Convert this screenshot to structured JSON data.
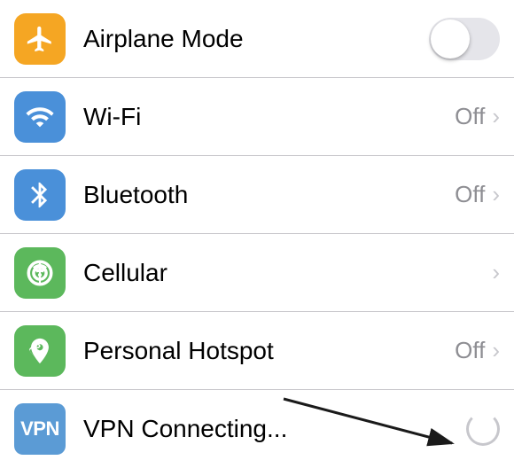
{
  "settings": {
    "rows": [
      {
        "id": "airplane-mode",
        "label": "Airplane Mode",
        "icon_type": "airplane",
        "control": "toggle",
        "value": "",
        "toggle_on": false
      },
      {
        "id": "wifi",
        "label": "Wi-Fi",
        "icon_type": "wifi",
        "control": "value-chevron",
        "value": "Off"
      },
      {
        "id": "bluetooth",
        "label": "Bluetooth",
        "icon_type": "bluetooth",
        "control": "value-chevron",
        "value": "Off"
      },
      {
        "id": "cellular",
        "label": "Cellular",
        "icon_type": "cellular",
        "control": "chevron",
        "value": ""
      },
      {
        "id": "personal-hotspot",
        "label": "Personal Hotspot",
        "icon_type": "hotspot",
        "control": "value-chevron",
        "value": "Off"
      },
      {
        "id": "vpn",
        "label": "VPN Connecting...",
        "icon_type": "vpn",
        "control": "spinner",
        "value": ""
      }
    ]
  }
}
